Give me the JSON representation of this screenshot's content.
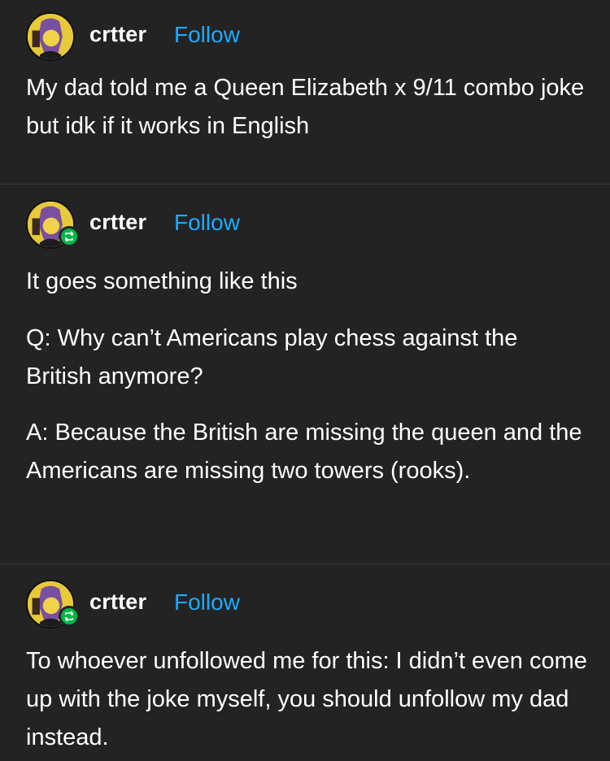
{
  "posts": [
    {
      "username": "crtter",
      "follow_label": "Follow",
      "paragraphs": [
        "My dad told me a Queen Elizabeth x 9/11 combo joke but idk if it works in English"
      ]
    },
    {
      "username": "crtter",
      "follow_label": "Follow",
      "reblog": true,
      "paragraphs": [
        "It goes something like this",
        "Q: Why can’t Americans play chess against the British anymore?",
        "A: Because the British are missing the queen and the Americans are missing two towers (rooks)."
      ]
    },
    {
      "username": "crtter",
      "follow_label": "Follow",
      "reblog": true,
      "paragraphs": [
        "To whoever unfollowed me for this: I didn’t even come up with the joke myself, you should unfollow my dad instead."
      ]
    }
  ],
  "colors": {
    "background": "#232323",
    "text": "#ffffff",
    "follow": "#1eaaff",
    "reblog_badge": "#00b846",
    "divider": "#3a3a3a"
  },
  "icons": {
    "avatar": "avatar-icon",
    "reblog": "reblog-icon"
  }
}
